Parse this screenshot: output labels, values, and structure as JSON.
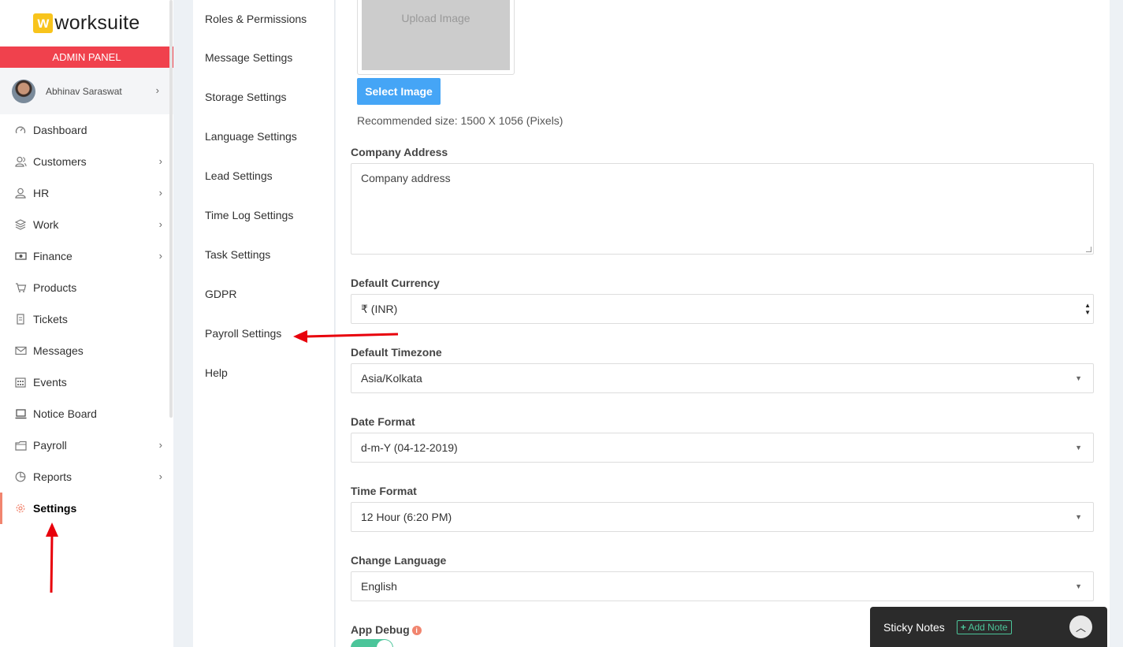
{
  "brand": {
    "logo_letter": "w",
    "logo_text": "worksuite",
    "panel_label": "ADMIN PANEL"
  },
  "user": {
    "name": "Abhinav Saraswat"
  },
  "sidebar": {
    "items": [
      {
        "label": "Dashboard",
        "icon": "dashboard-icon",
        "has_children": false
      },
      {
        "label": "Customers",
        "icon": "customers-icon",
        "has_children": true
      },
      {
        "label": "HR",
        "icon": "hr-icon",
        "has_children": true
      },
      {
        "label": "Work",
        "icon": "layers-icon",
        "has_children": true
      },
      {
        "label": "Finance",
        "icon": "money-icon",
        "has_children": true
      },
      {
        "label": "Products",
        "icon": "cart-icon",
        "has_children": false
      },
      {
        "label": "Tickets",
        "icon": "ticket-icon",
        "has_children": false
      },
      {
        "label": "Messages",
        "icon": "envelope-icon",
        "has_children": false
      },
      {
        "label": "Events",
        "icon": "calendar-icon",
        "has_children": false
      },
      {
        "label": "Notice Board",
        "icon": "notice-icon",
        "has_children": false
      },
      {
        "label": "Payroll",
        "icon": "wallet-icon",
        "has_children": true
      },
      {
        "label": "Reports",
        "icon": "pie-chart-icon",
        "has_children": true
      },
      {
        "label": "Settings",
        "icon": "gear-icon",
        "has_children": false,
        "active": true
      }
    ]
  },
  "settings_menu": {
    "items": [
      "Roles & Permissions",
      "Message Settings",
      "Storage Settings",
      "Language Settings",
      "Lead Settings",
      "Time Log Settings",
      "Task Settings",
      "GDPR",
      "Payroll Settings",
      "Help"
    ]
  },
  "form": {
    "upload_placeholder": "Upload Image",
    "select_image_label": "Select Image",
    "recommended_size": "Recommended size: 1500 X 1056 (Pixels)",
    "company_address": {
      "label": "Company Address",
      "value": "Company address"
    },
    "default_currency": {
      "label": "Default Currency",
      "value": "₹ (INR)"
    },
    "default_timezone": {
      "label": "Default Timezone",
      "value": "Asia/Kolkata"
    },
    "date_format": {
      "label": "Date Format",
      "value": "d-m-Y (04-12-2019)"
    },
    "time_format": {
      "label": "Time Format",
      "value": "12 Hour (6:20 PM)"
    },
    "change_language": {
      "label": "Change Language",
      "value": "English"
    },
    "app_debug": {
      "label": "App Debug",
      "enabled": true
    }
  },
  "sticky_notes": {
    "title": "Sticky Notes",
    "add_label": "Add Note"
  },
  "colors": {
    "accent_red": "#f0414d",
    "active_orange": "#f1856f",
    "button_blue": "#45a5f6",
    "toggle_green": "#4cc59a",
    "annotation_red": "#e8000b"
  }
}
